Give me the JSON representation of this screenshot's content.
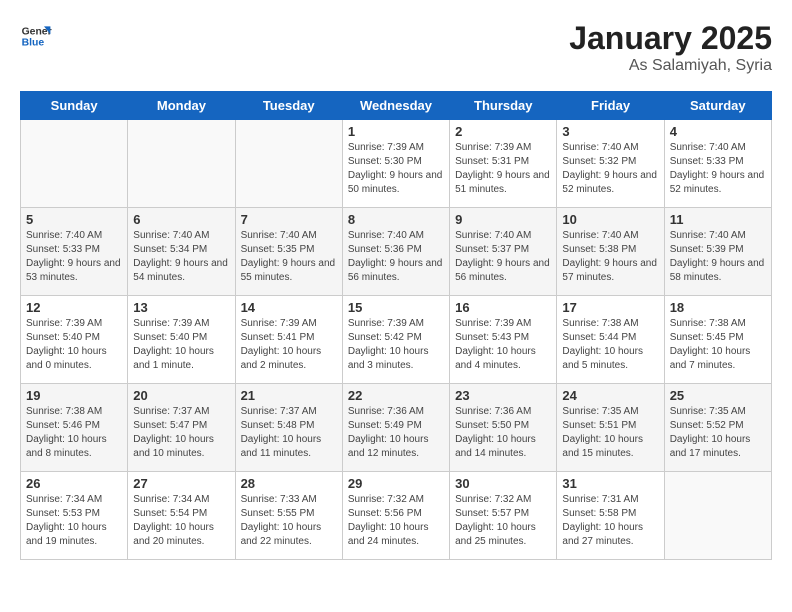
{
  "logo": {
    "line1": "General",
    "line2": "Blue"
  },
  "title": "January 2025",
  "subtitle": "As Salamiyah, Syria",
  "days_header": [
    "Sunday",
    "Monday",
    "Tuesday",
    "Wednesday",
    "Thursday",
    "Friday",
    "Saturday"
  ],
  "weeks": [
    [
      {
        "day": "",
        "sunrise": "",
        "sunset": "",
        "daylight": ""
      },
      {
        "day": "",
        "sunrise": "",
        "sunset": "",
        "daylight": ""
      },
      {
        "day": "",
        "sunrise": "",
        "sunset": "",
        "daylight": ""
      },
      {
        "day": "1",
        "sunrise": "Sunrise: 7:39 AM",
        "sunset": "Sunset: 5:30 PM",
        "daylight": "Daylight: 9 hours and 50 minutes."
      },
      {
        "day": "2",
        "sunrise": "Sunrise: 7:39 AM",
        "sunset": "Sunset: 5:31 PM",
        "daylight": "Daylight: 9 hours and 51 minutes."
      },
      {
        "day": "3",
        "sunrise": "Sunrise: 7:40 AM",
        "sunset": "Sunset: 5:32 PM",
        "daylight": "Daylight: 9 hours and 52 minutes."
      },
      {
        "day": "4",
        "sunrise": "Sunrise: 7:40 AM",
        "sunset": "Sunset: 5:33 PM",
        "daylight": "Daylight: 9 hours and 52 minutes."
      }
    ],
    [
      {
        "day": "5",
        "sunrise": "Sunrise: 7:40 AM",
        "sunset": "Sunset: 5:33 PM",
        "daylight": "Daylight: 9 hours and 53 minutes."
      },
      {
        "day": "6",
        "sunrise": "Sunrise: 7:40 AM",
        "sunset": "Sunset: 5:34 PM",
        "daylight": "Daylight: 9 hours and 54 minutes."
      },
      {
        "day": "7",
        "sunrise": "Sunrise: 7:40 AM",
        "sunset": "Sunset: 5:35 PM",
        "daylight": "Daylight: 9 hours and 55 minutes."
      },
      {
        "day": "8",
        "sunrise": "Sunrise: 7:40 AM",
        "sunset": "Sunset: 5:36 PM",
        "daylight": "Daylight: 9 hours and 56 minutes."
      },
      {
        "day": "9",
        "sunrise": "Sunrise: 7:40 AM",
        "sunset": "Sunset: 5:37 PM",
        "daylight": "Daylight: 9 hours and 56 minutes."
      },
      {
        "day": "10",
        "sunrise": "Sunrise: 7:40 AM",
        "sunset": "Sunset: 5:38 PM",
        "daylight": "Daylight: 9 hours and 57 minutes."
      },
      {
        "day": "11",
        "sunrise": "Sunrise: 7:40 AM",
        "sunset": "Sunset: 5:39 PM",
        "daylight": "Daylight: 9 hours and 58 minutes."
      }
    ],
    [
      {
        "day": "12",
        "sunrise": "Sunrise: 7:39 AM",
        "sunset": "Sunset: 5:40 PM",
        "daylight": "Daylight: 10 hours and 0 minutes."
      },
      {
        "day": "13",
        "sunrise": "Sunrise: 7:39 AM",
        "sunset": "Sunset: 5:40 PM",
        "daylight": "Daylight: 10 hours and 1 minute."
      },
      {
        "day": "14",
        "sunrise": "Sunrise: 7:39 AM",
        "sunset": "Sunset: 5:41 PM",
        "daylight": "Daylight: 10 hours and 2 minutes."
      },
      {
        "day": "15",
        "sunrise": "Sunrise: 7:39 AM",
        "sunset": "Sunset: 5:42 PM",
        "daylight": "Daylight: 10 hours and 3 minutes."
      },
      {
        "day": "16",
        "sunrise": "Sunrise: 7:39 AM",
        "sunset": "Sunset: 5:43 PM",
        "daylight": "Daylight: 10 hours and 4 minutes."
      },
      {
        "day": "17",
        "sunrise": "Sunrise: 7:38 AM",
        "sunset": "Sunset: 5:44 PM",
        "daylight": "Daylight: 10 hours and 5 minutes."
      },
      {
        "day": "18",
        "sunrise": "Sunrise: 7:38 AM",
        "sunset": "Sunset: 5:45 PM",
        "daylight": "Daylight: 10 hours and 7 minutes."
      }
    ],
    [
      {
        "day": "19",
        "sunrise": "Sunrise: 7:38 AM",
        "sunset": "Sunset: 5:46 PM",
        "daylight": "Daylight: 10 hours and 8 minutes."
      },
      {
        "day": "20",
        "sunrise": "Sunrise: 7:37 AM",
        "sunset": "Sunset: 5:47 PM",
        "daylight": "Daylight: 10 hours and 10 minutes."
      },
      {
        "day": "21",
        "sunrise": "Sunrise: 7:37 AM",
        "sunset": "Sunset: 5:48 PM",
        "daylight": "Daylight: 10 hours and 11 minutes."
      },
      {
        "day": "22",
        "sunrise": "Sunrise: 7:36 AM",
        "sunset": "Sunset: 5:49 PM",
        "daylight": "Daylight: 10 hours and 12 minutes."
      },
      {
        "day": "23",
        "sunrise": "Sunrise: 7:36 AM",
        "sunset": "Sunset: 5:50 PM",
        "daylight": "Daylight: 10 hours and 14 minutes."
      },
      {
        "day": "24",
        "sunrise": "Sunrise: 7:35 AM",
        "sunset": "Sunset: 5:51 PM",
        "daylight": "Daylight: 10 hours and 15 minutes."
      },
      {
        "day": "25",
        "sunrise": "Sunrise: 7:35 AM",
        "sunset": "Sunset: 5:52 PM",
        "daylight": "Daylight: 10 hours and 17 minutes."
      }
    ],
    [
      {
        "day": "26",
        "sunrise": "Sunrise: 7:34 AM",
        "sunset": "Sunset: 5:53 PM",
        "daylight": "Daylight: 10 hours and 19 minutes."
      },
      {
        "day": "27",
        "sunrise": "Sunrise: 7:34 AM",
        "sunset": "Sunset: 5:54 PM",
        "daylight": "Daylight: 10 hours and 20 minutes."
      },
      {
        "day": "28",
        "sunrise": "Sunrise: 7:33 AM",
        "sunset": "Sunset: 5:55 PM",
        "daylight": "Daylight: 10 hours and 22 minutes."
      },
      {
        "day": "29",
        "sunrise": "Sunrise: 7:32 AM",
        "sunset": "Sunset: 5:56 PM",
        "daylight": "Daylight: 10 hours and 24 minutes."
      },
      {
        "day": "30",
        "sunrise": "Sunrise: 7:32 AM",
        "sunset": "Sunset: 5:57 PM",
        "daylight": "Daylight: 10 hours and 25 minutes."
      },
      {
        "day": "31",
        "sunrise": "Sunrise: 7:31 AM",
        "sunset": "Sunset: 5:58 PM",
        "daylight": "Daylight: 10 hours and 27 minutes."
      },
      {
        "day": "",
        "sunrise": "",
        "sunset": "",
        "daylight": ""
      }
    ]
  ]
}
